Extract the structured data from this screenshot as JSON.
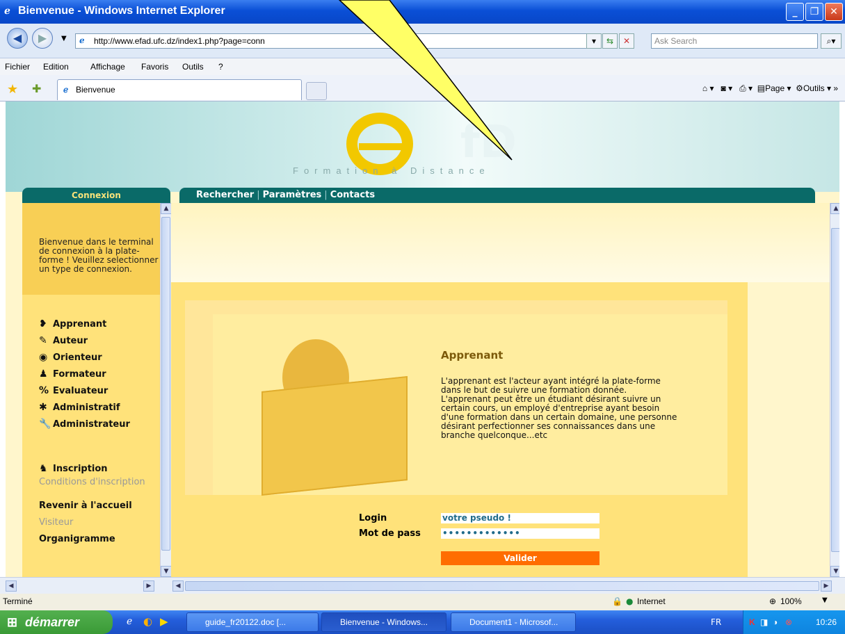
{
  "window": {
    "title": "Bienvenue - Windows Internet Explorer"
  },
  "address_bar": {
    "url": "http://www.efad.ufc.dz/index1.php?page=conn",
    "search_placeholder": "Ask Search"
  },
  "menu": [
    "Fichier",
    "Edition",
    "Affichage",
    "Favoris",
    "Outils",
    "?"
  ],
  "tabs": {
    "active": "Bienvenue"
  },
  "command_bar": {
    "page": "Page",
    "tools": "Outils"
  },
  "site": {
    "tagline": "Formation à Distance",
    "connexion_tab": "Connexion",
    "nav_links": [
      "Rechercher",
      "Paramètres",
      "Contacts"
    ],
    "intro": "Bienvenue dans le terminal de connexion à la plate-forme ! Veuillez selectionner un type de connexion.",
    "roles": [
      {
        "label": "Apprenant",
        "icon": "learner-icon"
      },
      {
        "label": "Auteur",
        "icon": "author-icon"
      },
      {
        "label": "Orienteur",
        "icon": "orienteer-icon"
      },
      {
        "label": "Formateur",
        "icon": "trainer-icon"
      },
      {
        "label": "Evaluateur",
        "icon": "evaluator-icon"
      },
      {
        "label": "Administratif",
        "icon": "administrative-icon"
      },
      {
        "label": "Administrateur",
        "icon": "administrator-icon"
      }
    ],
    "inscription": "Inscription",
    "conditions": "Conditions d'inscription",
    "home": "Revenir à l'accueil",
    "visitor": "Visiteur",
    "organigram": "Organigramme",
    "role_title": "Apprenant",
    "role_description": "L'apprenant est l'acteur ayant intégré la plate-forme dans le but de suivre une formation donnée. L'apprenant peut être un étudiant désirant suivre un certain cours, un employé d'entreprise ayant besoin d'une formation dans un certain domaine, une personne désirant perfectionner ses connaissances dans une branche quelconque...etc",
    "login_label": "Login",
    "password_label": "Mot de pass",
    "login_value": "votre pseudo !",
    "password_value": "•••••••••••••",
    "submit": "Valider"
  },
  "status": {
    "text": "Terminé",
    "zone": "Internet",
    "zoom": "100%"
  },
  "taskbar": {
    "start": "démarrer",
    "tasks": [
      "guide_fr20122.doc [...",
      "Bienvenue - Windows...",
      "Document1 - Microsof..."
    ],
    "lang": "FR",
    "clock": "10:26"
  }
}
